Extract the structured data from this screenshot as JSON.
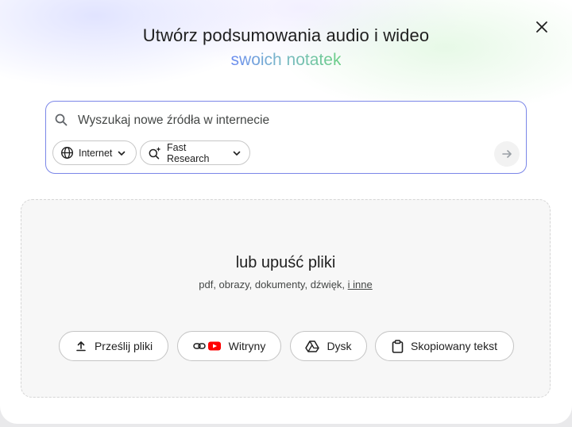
{
  "dialog": {
    "title": "Utwórz podsumowania audio i wideo",
    "subtitle": "swoich notatek",
    "close_icon": "close-icon"
  },
  "search": {
    "placeholder": "Wyszukaj nowe źródła w internecie",
    "value": "",
    "source_chip": {
      "label": "Internet",
      "icon": "globe-icon"
    },
    "mode_chip": {
      "label": "Fast Research",
      "icon": "sparkle-search-icon"
    },
    "submit_icon": "arrow-right-icon"
  },
  "upload_area": {
    "title": "lub upuść pliki",
    "file_types": "pdf, obrazy, dokumenty, dźwięk, ",
    "more_link": "i inne",
    "buttons": [
      {
        "label": "Prześlij pliki",
        "icon": "upload-icon"
      },
      {
        "label": "Witryny",
        "icon": "link-youtube-icon"
      },
      {
        "label": "Dysk",
        "icon": "drive-icon"
      },
      {
        "label": "Skopiowany tekst",
        "icon": "clipboard-icon"
      }
    ]
  },
  "colors": {
    "accent_border": "#7b86e8",
    "subtitle_gradient_start": "#6b8cf0",
    "subtitle_gradient_end": "#6ccf86",
    "youtube_red": "#ff0000"
  }
}
